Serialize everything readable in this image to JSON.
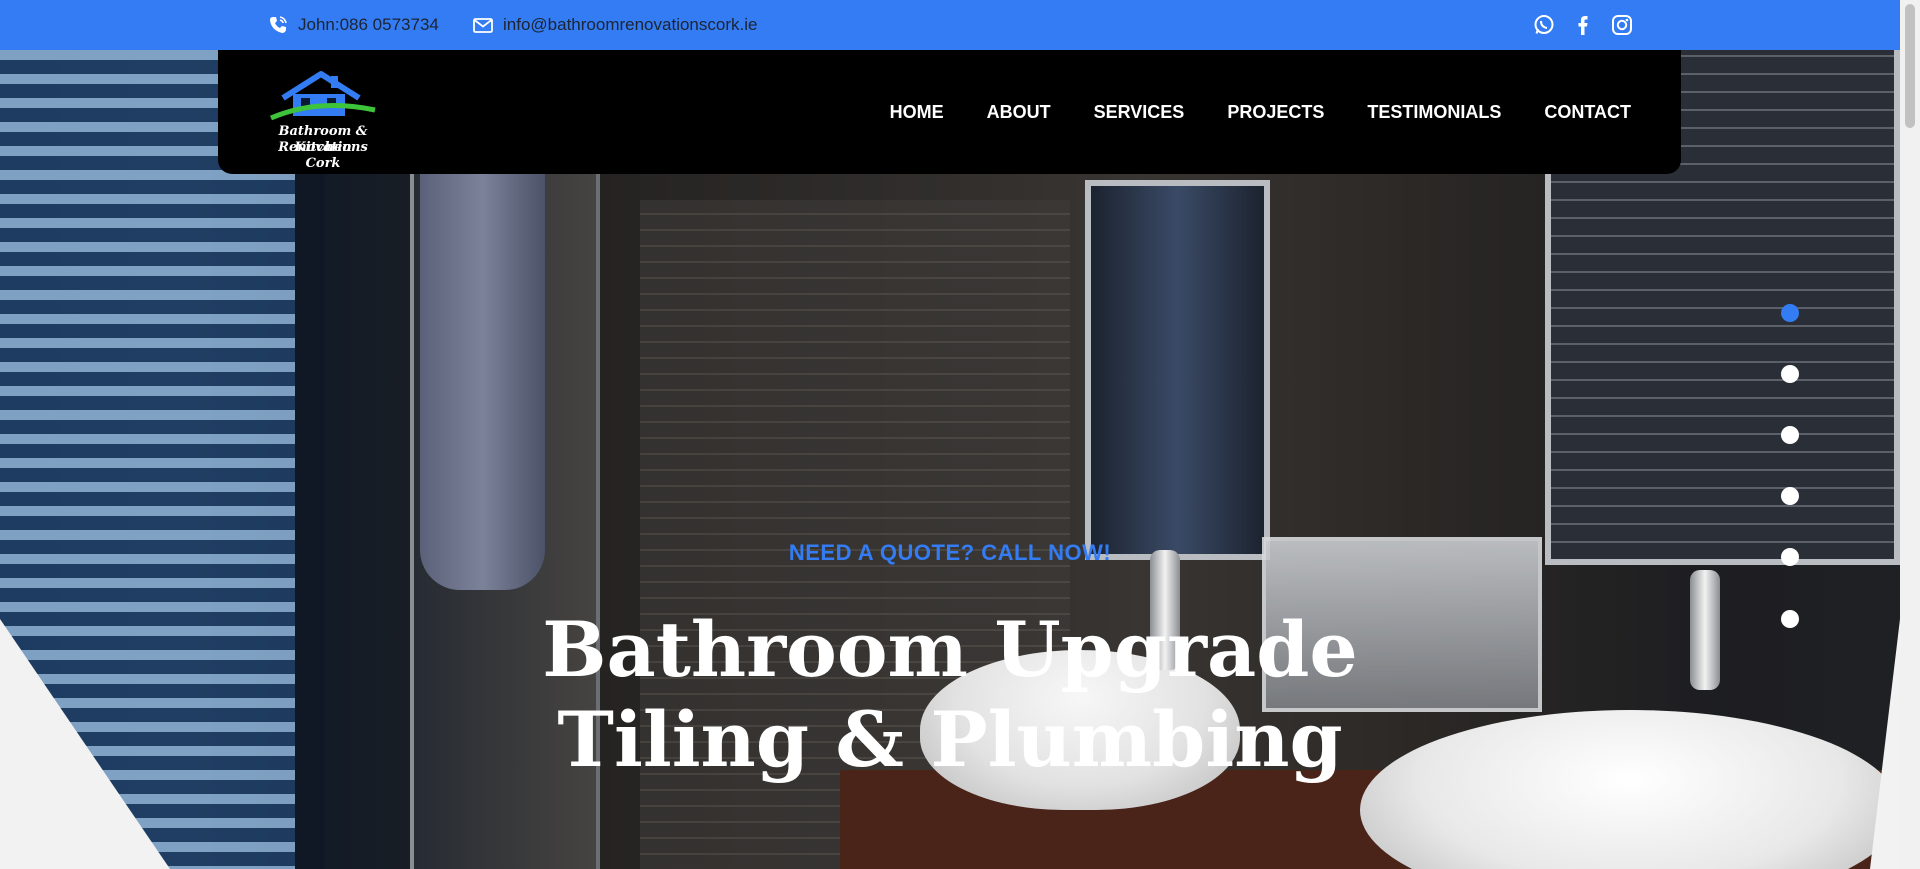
{
  "topbar": {
    "phone": "John:086 0573734",
    "email": "info@bathroomrenovationscork.ie",
    "social": [
      "whatsapp-icon",
      "facebook-icon",
      "instagram-icon"
    ],
    "color": "#337cf3"
  },
  "logo": {
    "line1": "Bathroom & Kitchen",
    "line2": "Renovations Cork"
  },
  "nav": {
    "home": "HOME",
    "about": "ABOUT",
    "services": "SERVICES",
    "projects": "PROJECTS",
    "testimonials": "TESTIMONIALS",
    "contact": "CONTACT"
  },
  "hero": {
    "eyebrow": "NEED A QUOTE? CALL NOW!",
    "headline_line1": "Bathroom Upgrade",
    "headline_line2": "Tiling & Plumbing",
    "slide_count": 6,
    "active_slide": 1
  }
}
